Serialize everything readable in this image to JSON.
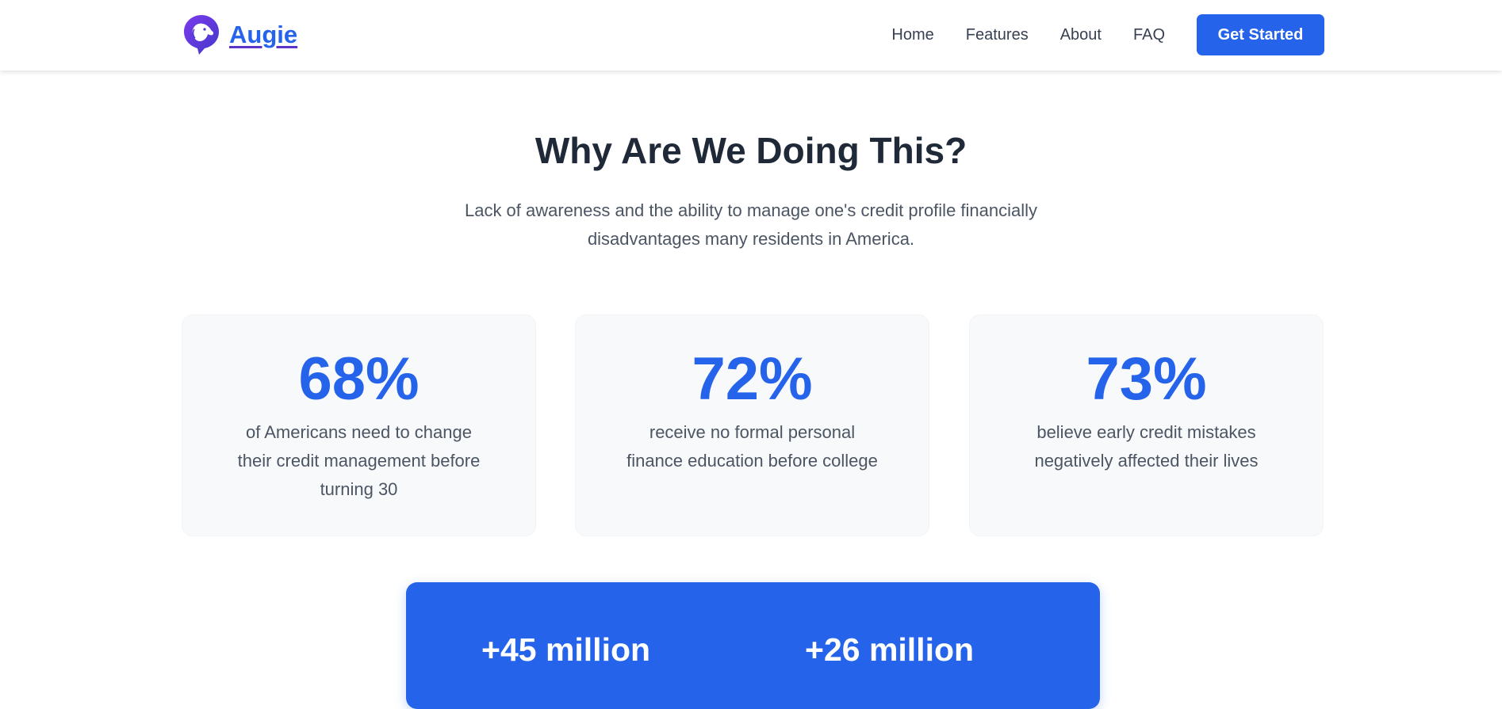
{
  "header": {
    "brand_name": "Augie",
    "nav": [
      "Home",
      "Features",
      "About",
      "FAQ"
    ],
    "cta_label": "Get Started"
  },
  "section": {
    "title": "Why Are We Doing This?",
    "subtitle_line1": "Lack of awareness and the ability to manage one's credit profile financially",
    "subtitle_line2": "disadvantages many residents in America."
  },
  "stats": [
    {
      "value": "68%",
      "lines": [
        "of Americans need to change",
        "their credit management before",
        "turning 30"
      ]
    },
    {
      "value": "72%",
      "lines": [
        "receive no formal personal",
        "finance education before college"
      ]
    },
    {
      "value": "73%",
      "lines": [
        "believe early credit mistakes",
        "negatively affected their lives"
      ]
    }
  ],
  "panel": {
    "stat1": "+45 million",
    "stat2": "+26 million"
  },
  "colors": {
    "accent": "#2563eb",
    "logo_purple": "#5b35c8",
    "heading": "#1f2937",
    "body_text": "#4b5563",
    "card_bg": "#f8f9fb"
  },
  "icons": {
    "logo": "dog-head-chat-bubble-icon"
  }
}
